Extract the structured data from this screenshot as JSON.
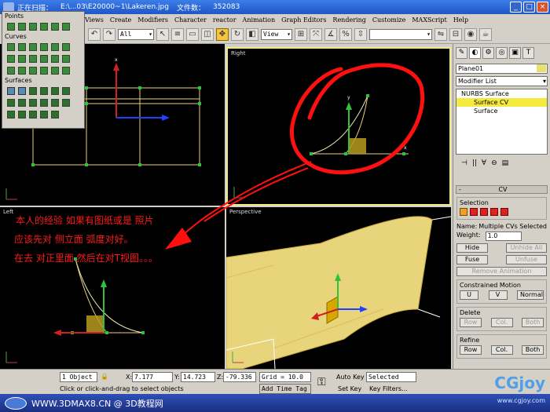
{
  "window": {
    "scan_status": "正在扫描：",
    "path": "E:\\...03\\E20000~1\\Lakeren.jpg",
    "file_count_label": "文件数：",
    "file_count": "352083"
  },
  "menu": [
    "Views",
    "Create",
    "Modifiers",
    "Character",
    "reactor",
    "Animation",
    "Graph Editors",
    "Rendering",
    "Customize",
    "MAXScript",
    "Help"
  ],
  "toolbar": {
    "filter": "All",
    "ref_coord": "View"
  },
  "floater": {
    "sections": [
      "Points",
      "Curves",
      "Surfaces"
    ]
  },
  "viewports": {
    "top_label": "",
    "right_label": "Right",
    "left_label": "Left",
    "persp_label": "Perspective"
  },
  "annotation": {
    "line1": "本人的经验   如果有图纸或是   照片",
    "line2": "应该先对  侧立面   弧度对好。",
    "line3": "在去  对正里面   然后在对T视图。。。"
  },
  "command_panel": {
    "object_name": "Plane01",
    "modifier_list": "Modifier List",
    "stack": [
      "NURBS Surface",
      "Surface CV",
      "Surface"
    ],
    "rollout_title": "CV",
    "selection_group": "Selection",
    "name_label": "Name:",
    "name_value": "Multiple CVs Selected",
    "weight_label": "Weight:",
    "weight_value": "1.0",
    "buttons": {
      "hide": "Hide",
      "unhide_all": "Unhide All",
      "fuse": "Fuse",
      "unfuse": "Unfuse",
      "remove_animation": "Remove Animation"
    },
    "constrained_motion": "Constrained Motion",
    "constraint_buttons": [
      "U",
      "V",
      "Normal"
    ],
    "delete_group": "Delete",
    "delete_buttons": [
      "Row",
      "Col.",
      "Both"
    ],
    "refine_group": "Refine",
    "refine_buttons": [
      "Row",
      "Col.",
      "Both"
    ]
  },
  "status": {
    "selection": "1 Object",
    "x_label": "X:",
    "x": "7.177",
    "y_label": "Y:",
    "y": "14.723",
    "z_label": "Z:",
    "z": "-79.336",
    "grid": "Grid = 10.0",
    "prompt": "Click or click-and-drag to select objects",
    "add_time_tag": "Add Time Tag",
    "auto_key": "Auto Key",
    "set_key": "Set Key",
    "selected": "Selected",
    "key_filters": "Key Filters..."
  },
  "watermark": {
    "left": "WWW.3DMAX8.CN @ 3D教程网",
    "right": "CGjoy",
    "right_sub": "www.cgjoy.com"
  },
  "colors": {
    "annotation": "#ff1a1a",
    "selected_stack": "#f5ea40",
    "surface": "#e8d47a"
  }
}
